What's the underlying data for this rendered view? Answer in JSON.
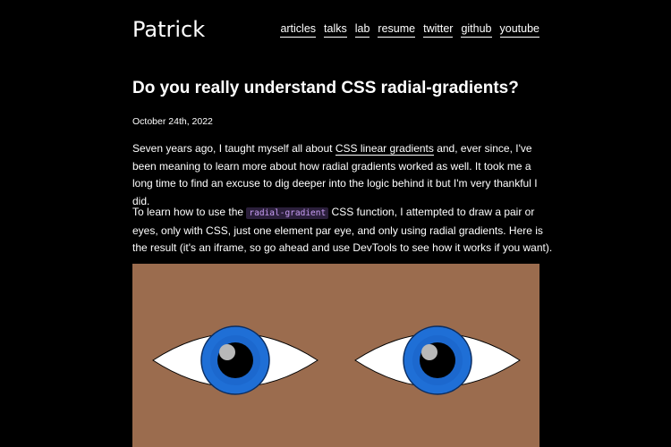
{
  "header": {
    "site_title": "Patrick",
    "nav": [
      {
        "label": "articles"
      },
      {
        "label": "talks"
      },
      {
        "label": "lab"
      },
      {
        "label": "resume"
      },
      {
        "label": "twitter"
      },
      {
        "label": "github"
      },
      {
        "label": "youtube"
      }
    ]
  },
  "article": {
    "title": "Do you really understand CSS radial-gradients?",
    "date": "October 24th, 2022",
    "p1": {
      "before": "Seven years ago, I taught myself all about ",
      "link": "CSS linear gradients",
      "after": " and, ever since, I've been meaning to learn more about how radial gradients worked as well. It took me a long time to find an excuse to dig deeper into the logic behind it but I'm very thankful I did."
    },
    "p2": {
      "before": "To learn how to use the ",
      "code": "radial-gradient",
      "after": " CSS function, I attempted to draw a pair or eyes, only with CSS, just one element par eye, and only using radial gradients. Here is the result (it's an iframe, so go ahead and use DevTools to see how it works if you want)."
    }
  },
  "demo": {
    "background_color": "#9b6c4e",
    "eye_white_color": "#ffffff",
    "iris_color": "#1f6fd6",
    "pupil_color": "#000000",
    "highlight_color": "#b8b8b8"
  }
}
